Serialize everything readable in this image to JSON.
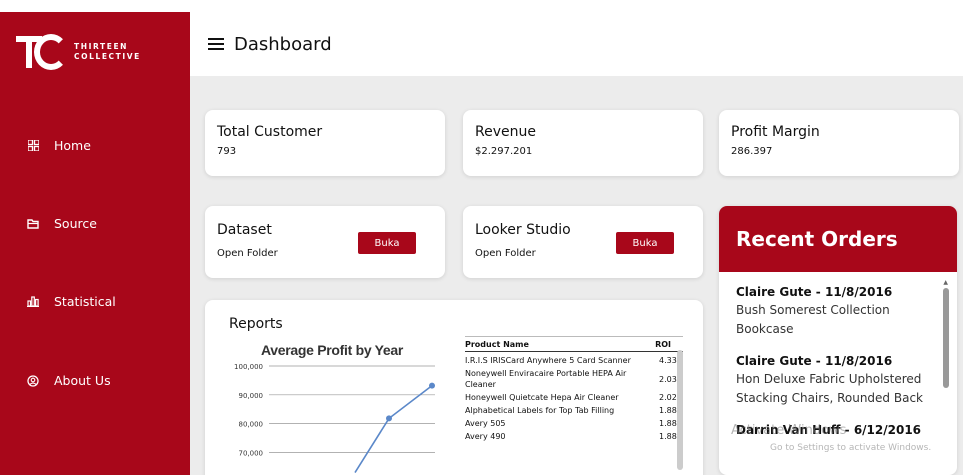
{
  "brand": {
    "line1": "THIRTEEN",
    "line2": "COLLECTIVE"
  },
  "nav": [
    {
      "label": "Home",
      "icon": "grid-icon"
    },
    {
      "label": "Source",
      "icon": "folder-icon"
    },
    {
      "label": "Statistical",
      "icon": "bar-chart-icon"
    },
    {
      "label": "About Us",
      "icon": "user-circle-icon"
    }
  ],
  "header": {
    "title": "Dashboard"
  },
  "stats": [
    {
      "title": "Total Customer",
      "value": "793"
    },
    {
      "title": "Revenue",
      "value": "$2.297.201"
    },
    {
      "title": "Profit Margin",
      "value": "286.397"
    }
  ],
  "links": [
    {
      "title": "Dataset",
      "subtitle": "Open Folder",
      "button": "Buka"
    },
    {
      "title": "Looker Studio",
      "subtitle": "Open Folder",
      "button": "Buka"
    }
  ],
  "reports": {
    "title": "Reports",
    "table": {
      "headers": [
        "Product Name",
        "ROI"
      ],
      "rows": [
        [
          "I.R.I.S IRISCard Anywhere 5 Card Scanner",
          "4.33"
        ],
        [
          "Noneywell Enviracaire Portable HEPA Air Cleaner",
          "2.03"
        ],
        [
          "Honeywell Quietcate Hepa Air Cleaner",
          "2.02"
        ],
        [
          "Alphabetical Labels for Top Tab Filling",
          "1.88"
        ],
        [
          "Avery 505",
          "1.88"
        ],
        [
          "Avery 490",
          "1.88"
        ]
      ]
    }
  },
  "chart_data": {
    "type": "line",
    "title": "Average Profit by Year",
    "ylim": [
      65000,
      100000
    ],
    "yticks": [
      "100,000",
      "90,000",
      "80,000",
      "70,000"
    ],
    "ytick_values": [
      100000,
      90000,
      80000,
      70000
    ],
    "series": [
      {
        "values": [
          63000,
          81800,
          93200
        ]
      }
    ],
    "grid": true,
    "color": "#5b88c9"
  },
  "recent_orders": {
    "title": "Recent Orders",
    "orders": [
      {
        "header": "Claire Gute - 11/8/2016",
        "item": "Bush Somerest Collection Bookcase"
      },
      {
        "header": "Claire Gute - 11/8/2016",
        "item": "Hon Deluxe Fabric Upholstered Stacking Chairs, Rounded Back"
      },
      {
        "header": "Darrin Van Huff - 6/12/2016",
        "item": ""
      }
    ]
  },
  "watermark": {
    "line1": "Activate Windows",
    "line2": "Go to Settings to activate Windows."
  },
  "colors": {
    "brand": "#a8071a",
    "background": "#ececec",
    "chart_line": "#5b88c9"
  }
}
